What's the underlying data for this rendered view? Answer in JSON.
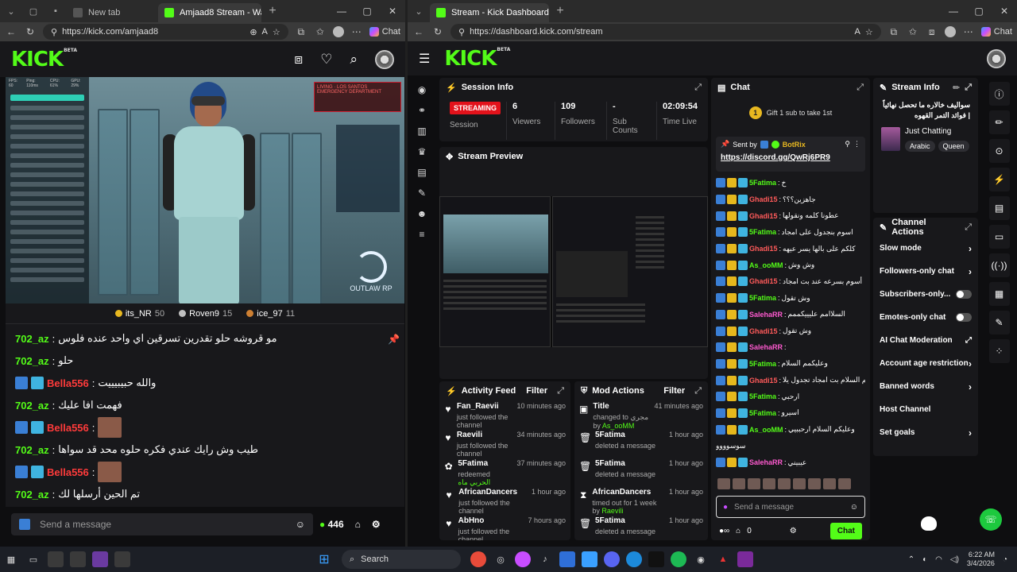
{
  "left_window": {
    "tabs": [
      {
        "title": "New tab",
        "active": false
      },
      {
        "title": "Amjaad8 Stream - Wa",
        "active": true
      }
    ],
    "url": "https://kick.com/amjaad8",
    "copilot_label": "Chat",
    "brand": "KICK",
    "brand_sup": "BETA",
    "video": {
      "hud_top": [
        "FPS: 60",
        "Ping: 110ms",
        "CPU: 61%",
        "GPU: 29%"
      ],
      "hud_alert": "LIVING · LOS SANTOS EMERGENCY DEPARTMENT",
      "server_logo": "OUTLAW RP"
    },
    "top_gifters": [
      {
        "name": "its_NR",
        "count": "50",
        "color": "#e8b820"
      },
      {
        "name": "Roven9",
        "count": "15",
        "color": "#c0c0c0"
      },
      {
        "name": "ice_97",
        "count": "11",
        "color": "#cd7f32"
      }
    ],
    "chat": [
      {
        "user": "702_az",
        "user_color": "#53fc18",
        "text": "مو قروشه حلو تقدرين تسرقين اي واحد عنده فلوس",
        "badges": false,
        "pic": false
      },
      {
        "user": "702_az",
        "user_color": "#53fc18",
        "text": "حلو",
        "badges": false,
        "pic": false
      },
      {
        "user": "Bella556",
        "user_color": "#ff3b3b",
        "text": "والله حبيبيييت",
        "badges": true,
        "pic": false
      },
      {
        "user": "702_az",
        "user_color": "#53fc18",
        "text": "فهمت افا عليك",
        "badges": false,
        "pic": false
      },
      {
        "user": "Bella556",
        "user_color": "#ff3b3b",
        "text": "",
        "badges": true,
        "pic": true
      },
      {
        "user": "702_az",
        "user_color": "#53fc18",
        "text": "طيب وش رايك عندي فكره حلوه محد قد سواها",
        "badges": false,
        "pic": false
      },
      {
        "user": "Bella556",
        "user_color": "#ff3b3b",
        "text": "",
        "badges": true,
        "pic": true
      },
      {
        "user": "702_az",
        "user_color": "#53fc18",
        "text": "تم الحين أرسلها لك",
        "badges": false,
        "pic": false
      }
    ],
    "input_placeholder": "Send a message",
    "points": "446"
  },
  "right_window": {
    "tabs": [
      {
        "title": "Stream - Kick Dashboard",
        "active": true
      }
    ],
    "url": "https://dashboard.kick.com/stream",
    "copilot_label": "Chat",
    "brand": "KICK",
    "brand_sup": "BETA",
    "session": {
      "title": "Session Info",
      "status": "STREAMING",
      "status_label": "Session",
      "stats": [
        {
          "value": "6",
          "label": "Viewers"
        },
        {
          "value": "109",
          "label": "Followers"
        },
        {
          "value": "-",
          "label": "Sub Counts"
        },
        {
          "value": "02:09:54",
          "label": "Time Live"
        }
      ]
    },
    "preview_title": "Stream Preview",
    "activity": {
      "title": "Activity Feed",
      "filter": "Filter",
      "items": [
        {
          "icon": "heart",
          "name": "Fan_Raevii",
          "sub": "just followed the channel",
          "time": "10 minutes ago"
        },
        {
          "icon": "heart",
          "name": "Raevili",
          "sub": "just followed the channel",
          "time": "34 minutes ago"
        },
        {
          "icon": "gift",
          "name": "5Fatima",
          "sub": "redeemed",
          "sub_hl": "الحربي ماه",
          "time": "37 minutes ago"
        },
        {
          "icon": "heart",
          "name": "AfricanDancers",
          "sub": "just followed the channel",
          "time": "1 hour ago"
        },
        {
          "icon": "heart",
          "name": "AbHno",
          "sub": "just followed the channel",
          "time": "7 hours ago"
        }
      ]
    },
    "mod_actions": {
      "title": "Mod Actions",
      "filter": "Filter",
      "items": [
        {
          "icon": "user",
          "name": "Title",
          "sub": "changed to مجري by",
          "sub_hl": "As_ooMM",
          "time": "41 minutes ago"
        },
        {
          "icon": "trash",
          "name": "5Fatima",
          "sub": "deleted a message",
          "sub_hl": "",
          "time": "1 hour ago"
        },
        {
          "icon": "trash",
          "name": "5Fatima",
          "sub": "deleted a message",
          "sub_hl": "",
          "time": "1 hour ago"
        },
        {
          "icon": "timer",
          "name": "AfricanDancers",
          "sub": "timed out for 1 week by",
          "sub_hl": "Raevili",
          "time": "1 hour ago"
        },
        {
          "icon": "trash",
          "name": "5Fatima",
          "sub": "deleted a message",
          "sub_hl": "",
          "time": "1 hour ago"
        }
      ]
    },
    "chat": {
      "title": "Chat",
      "gift_text": "Gift 1 sub to take 1st",
      "gift_coin": "1",
      "pinned_sender_label": "Sent by",
      "pinned_sender": "BotRix",
      "pinned_link": "https://discord.gg/QwRj6PR9",
      "messages": [
        {
          "user": "5Fatima",
          "color": "#53fc18",
          "text": "خ"
        },
        {
          "user": "Ghadi15",
          "color": "#ff5a5a",
          "text": "جاهزين؟؟؟"
        },
        {
          "user": "Ghadi15",
          "color": "#ff5a5a",
          "text": "عطونا كلمه ونقولها"
        },
        {
          "user": "5Fatima",
          "color": "#53fc18",
          "text": "اسوم بنجدول على امجاد"
        },
        {
          "user": "Ghadi15",
          "color": "#ff5a5a",
          "text": "كلكم على بالها يسر عيهه"
        },
        {
          "user": "As_ooMM",
          "color": "#53fc18",
          "text": "وش وش"
        },
        {
          "user": "Ghadi15",
          "color": "#ff5a5a",
          "text": "أسوم بسرعه عند بت امجاد"
        },
        {
          "user": "5Fatima",
          "color": "#53fc18",
          "text": "وش تقول"
        },
        {
          "user": "SalehaRR",
          "color": "#ff5ad0",
          "text": "السلاامم عليييكممم"
        },
        {
          "user": "Ghadi15",
          "color": "#ff5a5a",
          "text": "وش تقول"
        },
        {
          "user": "SalehaRR",
          "color": "#ff5ad0",
          "text": ""
        },
        {
          "user": "5Fatima",
          "color": "#53fc18",
          "text": "وعليكمم السلام"
        },
        {
          "user": "Ghadi15",
          "color": "#ff5a5a",
          "text": "وعليكم السلام بت امجاد تجدول يلا"
        },
        {
          "user": "5Fatima",
          "color": "#53fc18",
          "text": "ارحبي"
        },
        {
          "user": "5Fatima",
          "color": "#53fc18",
          "text": "اسيرو"
        },
        {
          "user": "As_ooMM",
          "color": "#53fc18",
          "text": "وعليكم السلام ارحببيي"
        },
        {
          "user": "",
          "color": "#ffffff",
          "text": "سوسوووو"
        },
        {
          "user": "SalehaRR",
          "color": "#ff5ad0",
          "text": "عيبيني"
        }
      ],
      "input_placeholder": "Send a message",
      "count": "0",
      "send_label": "Chat"
    },
    "stream_info": {
      "title": "Stream Info",
      "stream_title": "سواليف خالاره ما تحصل نهائياً | فوائد التمر القهوه",
      "category": "Just Chatting",
      "tags": [
        "Arabic",
        "Queen"
      ]
    },
    "channel_actions": {
      "title": "Channel Actions",
      "items": [
        {
          "label": "Slow mode",
          "control": "chevron"
        },
        {
          "label": "Followers-only chat",
          "control": "chevron"
        },
        {
          "label": "Subscribers-only...",
          "control": "toggle"
        },
        {
          "label": "Emotes-only chat",
          "control": "toggle"
        },
        {
          "label": "AI Chat Moderation",
          "control": "external"
        },
        {
          "label": "Account age restriction",
          "control": "chevron"
        },
        {
          "label": "Banned words",
          "control": "chevron"
        },
        {
          "label": "Host Channel",
          "control": "none"
        },
        {
          "label": "Set goals",
          "control": "chevron"
        }
      ]
    }
  },
  "taskbar": {
    "search_label": "Search",
    "time": "6:22 AM",
    "date": "3/4/2026"
  },
  "colors": {
    "kick_green": "#53fc18",
    "streaming_red": "#e3121b",
    "bg": "#0e0e10",
    "panel": "#18181b"
  }
}
